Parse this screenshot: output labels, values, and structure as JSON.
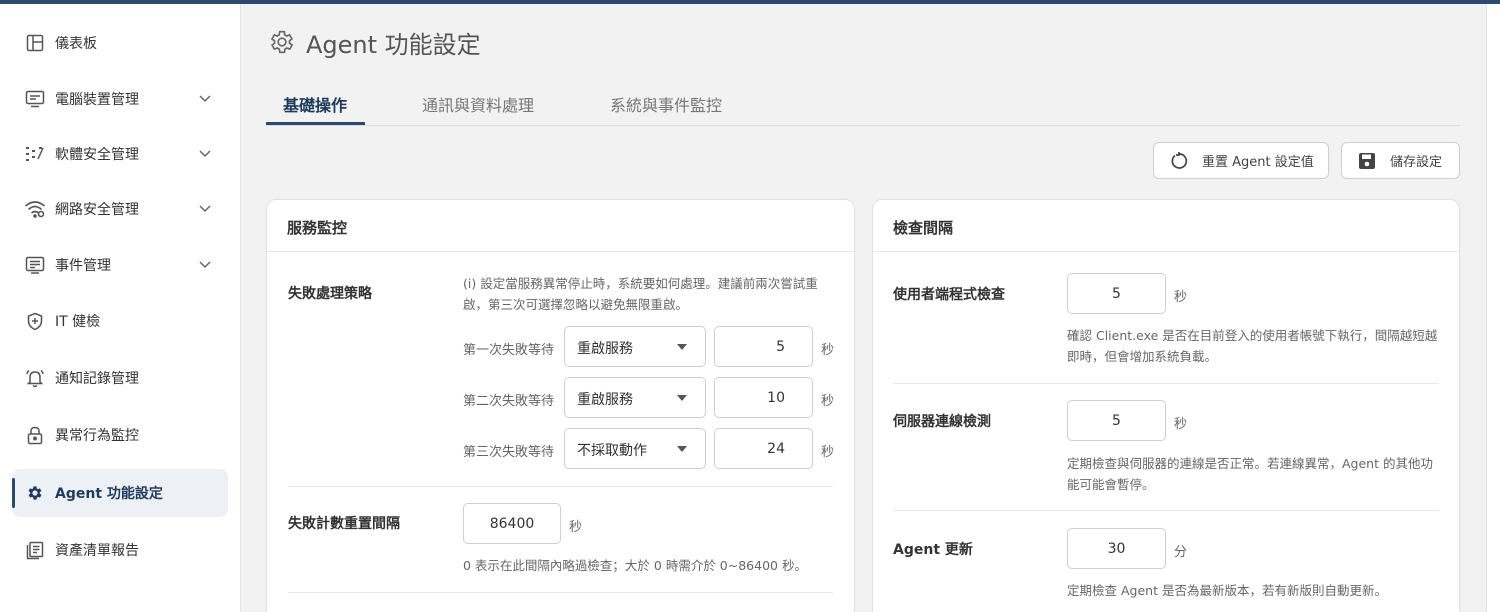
{
  "sidebar": {
    "items": [
      {
        "label": "儀表板",
        "icon": "layout-icon",
        "expandable": false
      },
      {
        "label": "電腦裝置管理",
        "icon": "monitor-icon",
        "expandable": true
      },
      {
        "label": "軟體安全管理",
        "icon": "software-icon",
        "expandable": true
      },
      {
        "label": "網路安全管理",
        "icon": "wifi-icon",
        "expandable": true
      },
      {
        "label": "事件管理",
        "icon": "event-icon",
        "expandable": true
      },
      {
        "label": "IT 健檢",
        "icon": "shield-icon",
        "expandable": false
      },
      {
        "label": "通知記錄管理",
        "icon": "bell-icon",
        "expandable": false
      },
      {
        "label": "異常行為監控",
        "icon": "lock-icon",
        "expandable": false
      },
      {
        "label": "Agent 功能設定",
        "icon": "gear-icon",
        "expandable": false,
        "active": true
      },
      {
        "label": "資產清單報告",
        "icon": "report-icon",
        "expandable": false
      }
    ]
  },
  "header": {
    "title": "Agent 功能設定"
  },
  "tabs": [
    {
      "label": "基礎操作",
      "active": true
    },
    {
      "label": "通訊與資料處理"
    },
    {
      "label": "系統與事件監控"
    }
  ],
  "toolbar": {
    "reset_label": "重置 Agent 設定值",
    "save_label": "儲存設定"
  },
  "service_monitor": {
    "title": "服務監控",
    "failure_policy": {
      "label": "失敗處理策略",
      "hint": "(i) 設定當服務異常停止時，系統要如何處理。建議前兩次嘗試重啟，第三次可選擇忽略以避免無限重啟。",
      "rows": [
        {
          "label": "第一次失敗等待",
          "action": "重啟服務",
          "value": "5",
          "unit": "秒"
        },
        {
          "label": "第二次失敗等待",
          "action": "重啟服務",
          "value": "10",
          "unit": "秒"
        },
        {
          "label": "第三次失敗等待",
          "action": "不採取動作",
          "value": "24",
          "unit": "秒"
        }
      ]
    },
    "reset_interval": {
      "label": "失敗計數重置間隔",
      "value": "86400",
      "unit": "秒",
      "hint": "0 表示在此間隔內略過檢查；大於 0 時需介於 0~86400 秒。"
    }
  },
  "check_interval": {
    "title": "檢查間隔",
    "rows": [
      {
        "label": "使用者端程式檢查",
        "value": "5",
        "unit": "秒",
        "hint": "確認 Client.exe 是否在目前登入的使用者帳號下執行，間隔越短越即時，但會增加系統負載。"
      },
      {
        "label": "伺服器連線檢測",
        "value": "5",
        "unit": "秒",
        "hint": "定期檢查與伺服器的連線是否正常。若連線異常，Agent 的其他功能可能會暫停。"
      },
      {
        "label": "Agent 更新",
        "value": "30",
        "unit": "分",
        "hint": "定期檢查 Agent 是否為最新版本，若有新版則自動更新。"
      }
    ]
  }
}
